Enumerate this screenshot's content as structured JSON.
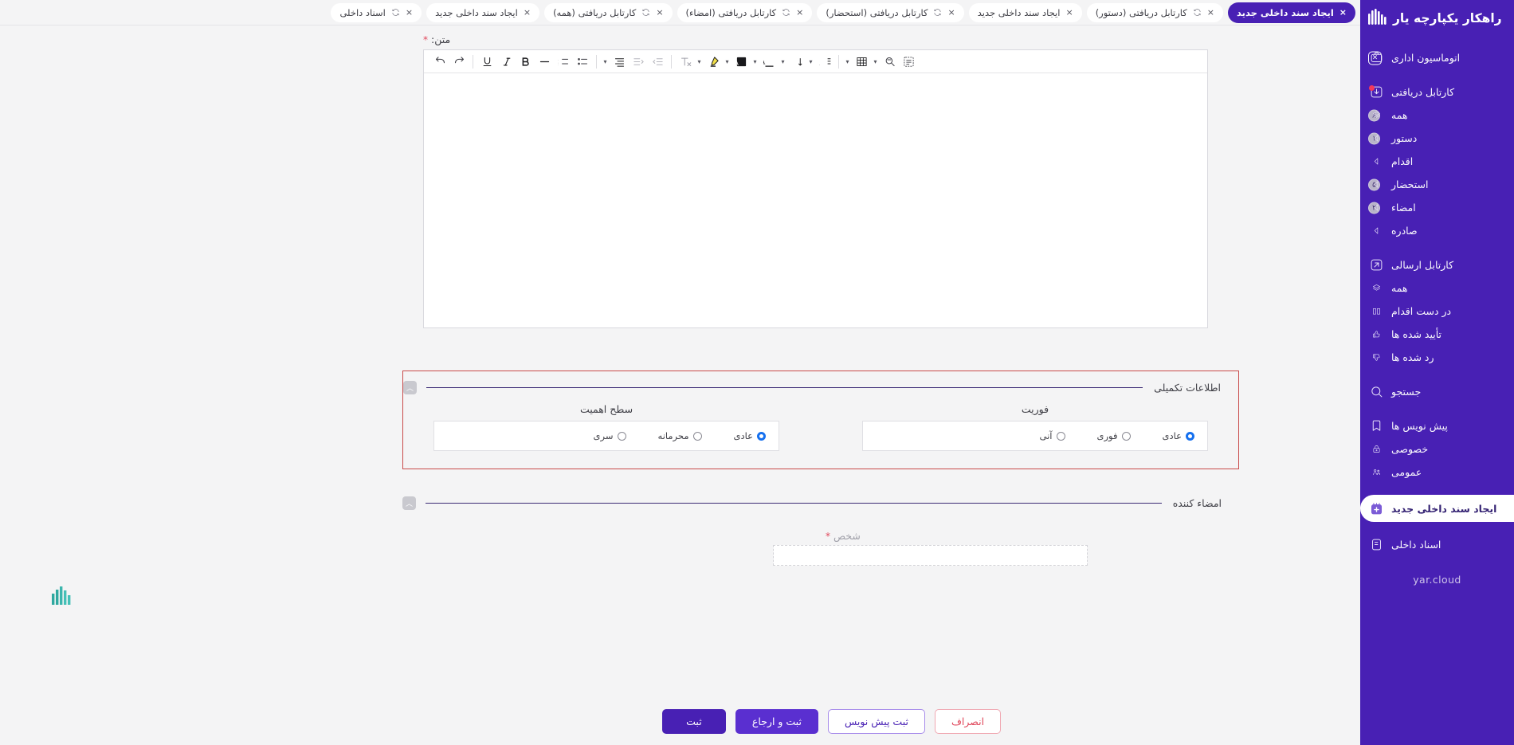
{
  "brand": {
    "name": "راهکار یکپارچه یار"
  },
  "sidebar": {
    "items": [
      {
        "label": "اتوماسیون اداری",
        "icon": "briefcase-icon",
        "kind": "group",
        "close": "×"
      },
      {
        "label": "کارتابل دریافتی",
        "icon": "inbox-down-icon",
        "kind": "group",
        "dot": true
      },
      {
        "label": "همه",
        "icon": "layers-icon",
        "kind": "sub-all",
        "badge": "۸"
      },
      {
        "label": "دستور",
        "icon": "caret-icon",
        "kind": "sub",
        "badge": "۱"
      },
      {
        "label": "اقدام",
        "icon": "caret-icon",
        "kind": "sub",
        "badge": ""
      },
      {
        "label": "استحضار",
        "icon": "caret-icon",
        "kind": "sub",
        "badge": "۵"
      },
      {
        "label": "امضاء",
        "icon": "caret-icon",
        "kind": "sub",
        "badge": "۲"
      },
      {
        "label": "صادره",
        "icon": "caret-icon",
        "kind": "sub",
        "badge": ""
      },
      {
        "label": "کارتابل ارسالی",
        "icon": "outbox-up-icon",
        "kind": "group"
      },
      {
        "label": "همه",
        "icon": "layers-icon",
        "kind": "sub-all",
        "badge": ""
      },
      {
        "label": "در دست اقدام",
        "icon": "book-open-icon",
        "kind": "sub-all",
        "badge": ""
      },
      {
        "label": "تأیید شده ها",
        "icon": "thumbs-up-icon",
        "kind": "sub-all",
        "badge": ""
      },
      {
        "label": "رد شده ها",
        "icon": "thumbs-down-icon",
        "kind": "sub-all",
        "badge": ""
      },
      {
        "label": "جستجو",
        "icon": "search-icon",
        "kind": "group"
      },
      {
        "label": "پیش نویس ها",
        "icon": "bookmark-icon",
        "kind": "group"
      },
      {
        "label": "خصوصی",
        "icon": "lock-icon",
        "kind": "sub-all",
        "badge": ""
      },
      {
        "label": "عمومی",
        "icon": "users-icon",
        "kind": "sub-all",
        "badge": ""
      },
      {
        "label": "ایجاد سند داخلی جدید",
        "icon": "note-plus-icon",
        "kind": "active"
      },
      {
        "label": "اسناد داخلی",
        "icon": "docs-icon",
        "kind": "group"
      }
    ],
    "cloud_label": "yar.cloud"
  },
  "tabs": [
    {
      "label": "ایجاد سند داخلی جدید",
      "active": true,
      "refresh": false,
      "close": "×"
    },
    {
      "label": "کارتابل دریافتی (دستور)",
      "active": false,
      "refresh": true,
      "close": "×"
    },
    {
      "label": "ایجاد سند داخلی جدید",
      "active": false,
      "refresh": false,
      "close": "×"
    },
    {
      "label": "کارتابل دریافتی (استحضار)",
      "active": false,
      "refresh": true,
      "close": "×"
    },
    {
      "label": "کارتابل دریافتی (امضاء)",
      "active": false,
      "refresh": true,
      "close": "×"
    },
    {
      "label": "کارتابل دریافتی (همه)",
      "active": false,
      "refresh": true,
      "close": "×"
    },
    {
      "label": "ایجاد سند داخلی جدید",
      "active": false,
      "refresh": false,
      "close": "×"
    },
    {
      "label": "اسناد داخلی",
      "active": false,
      "refresh": true,
      "close": "×"
    }
  ],
  "form": {
    "body_label": "متن:",
    "required_mark": "*",
    "toolbar": {
      "icons": [
        "redo-icon",
        "undo-icon",
        "bold-icon",
        "italic-icon",
        "underline-icon",
        "bullet-list-icon",
        "ordered-list-icon",
        "horizontal-rule-icon",
        "indent-icon",
        "outdent-icon",
        "align-icon",
        "font-size-icon",
        "line-height-icon",
        "text-color-icon",
        "highlight-bg-icon",
        "highlighter-icon",
        "clear-format-icon",
        "select-all-icon",
        "find-replace-icon",
        "table-icon"
      ]
    },
    "editor_content": ""
  },
  "extra_section": {
    "title": "اطلاعات تکمیلی",
    "collapse_icon": "chevron-up-icon",
    "importance": {
      "title": "سطح اهمیت",
      "options": [
        {
          "label": "عادی",
          "selected": true
        },
        {
          "label": "محرمانه",
          "selected": false
        },
        {
          "label": "سری",
          "selected": false
        }
      ]
    },
    "urgency": {
      "title": "فوریت",
      "options": [
        {
          "label": "عادی",
          "selected": true
        },
        {
          "label": "فوری",
          "selected": false
        },
        {
          "label": "آنی",
          "selected": false
        }
      ]
    }
  },
  "signer_section": {
    "title": "امضاء کننده",
    "collapse_icon": "chevron-up-icon",
    "person_label": "شخص",
    "person_required": "*",
    "person_value": ""
  },
  "footer": {
    "submit": "ثبت",
    "submit_refer": "ثبت و ارجاع",
    "save_draft": "ثبت پیش نویس",
    "cancel": "انصراف"
  },
  "colors": {
    "brand_purple": "#4820b4",
    "accent_purple": "#5a2fd0",
    "danger_red": "#e0485c",
    "radio_blue": "#1570ef",
    "card_border": "#c94a4a"
  }
}
